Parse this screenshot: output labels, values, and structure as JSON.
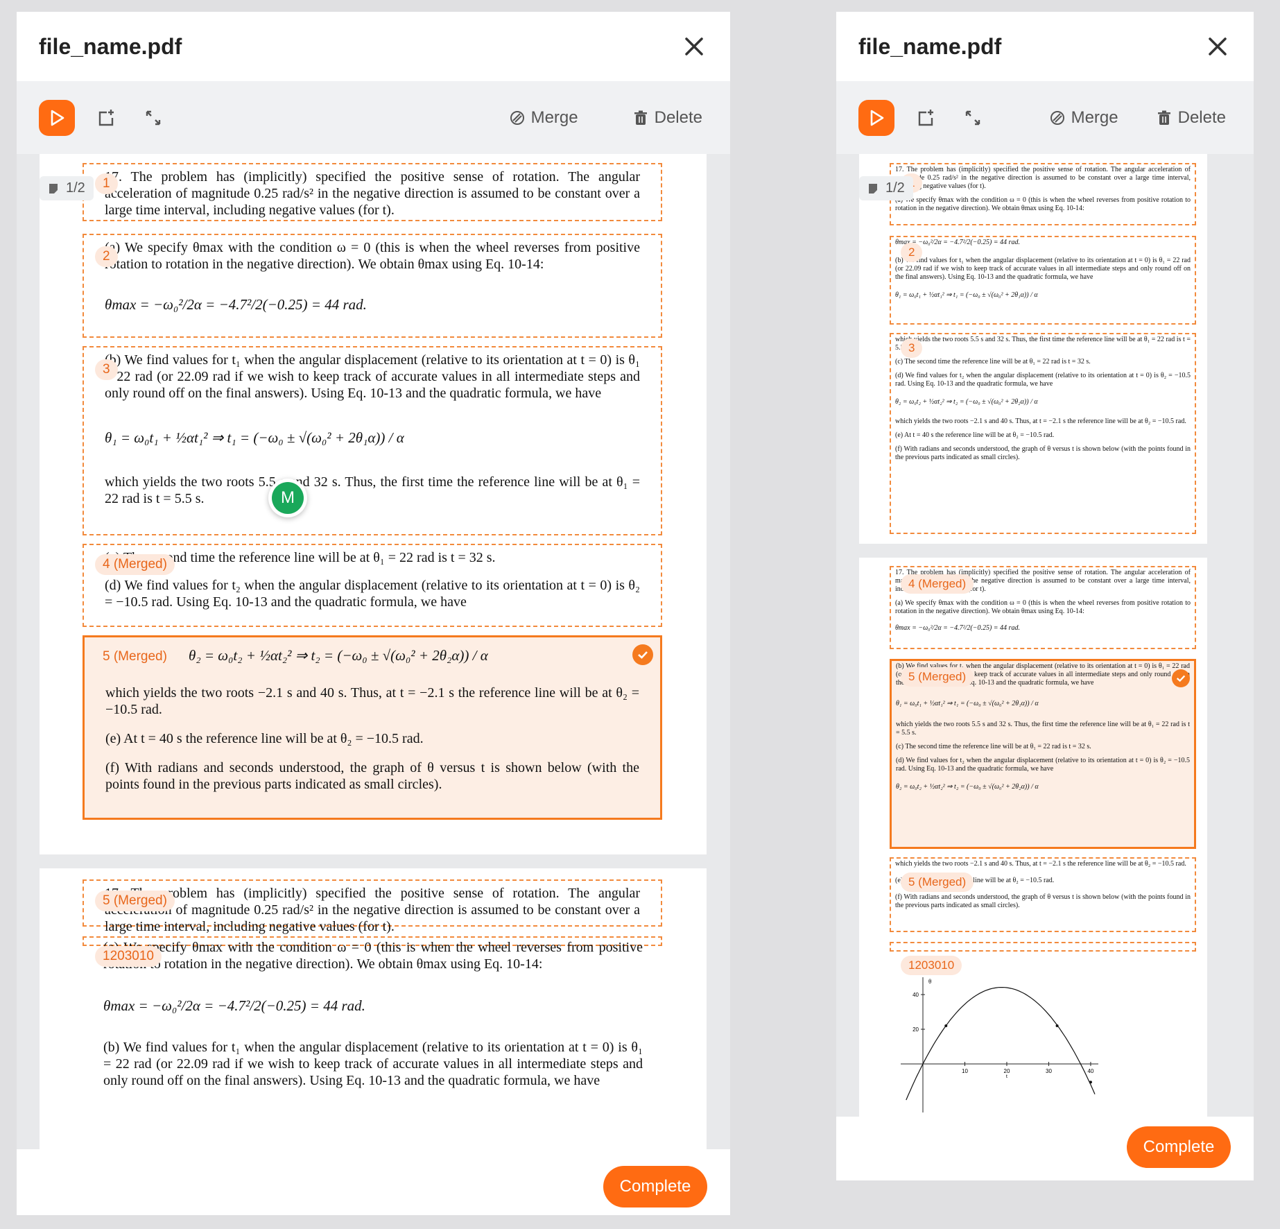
{
  "app": {
    "file_name": "file_name.pdf",
    "merge_label": "Merge",
    "delete_label": "Delete",
    "complete_label": "Complete",
    "page_indicator": "1/2",
    "avatar_initial": "M",
    "colors": {
      "accent": "#ff6b12",
      "selected_bg": "#fdeee4",
      "avatar": "#1aa85a"
    }
  },
  "left": {
    "tags": {
      "t1": "1",
      "t2": "2",
      "t3": "3",
      "t4": "4 (Merged)",
      "t5": "5 (Merged)",
      "t6": "5 (Merged)",
      "t7": "1203010"
    },
    "text": {
      "s1": "17. The problem has (implicitly) specified the positive sense of rotation. The angular acceleration of magnitude 0.25 rad/s² in the negative direction is assumed to be constant over a large time interval, including negative values (for t).",
      "s2": "(a) We specify θmax with the condition ω = 0 (this is when the wheel reverses from positive rotation to rotation in the negative direction). We obtain θmax using Eq. 10-14:",
      "s2eq": "θmax = −ω₀²/2α = −4.7²/2(−0.25) = 44 rad.",
      "s3": "(b) We find values for t₁ when the angular displacement (relative to its orientation at t = 0) is θ₁ = 22 rad (or 22.09 rad if we wish to keep track of accurate values in all intermediate steps and only round off on the final answers). Using Eq. 10-13 and the quadratic formula, we have",
      "s3eq": "θ₁ = ω₀t₁ + ½αt₁² ⇒ t₁ = (−ω₀ ± √(ω₀² + 2θ₁α)) / α",
      "s3b": "which yields the two roots 5.5 s and 32 s. Thus, the first time the reference line will be at θ₁ = 22 rad is t = 5.5 s.",
      "s4a": "(c) The second time the reference line will be at θ₁ = 22 rad is t = 32 s.",
      "s4b": "(d) We find values for t₂ when the angular displacement (relative to its orientation at t = 0) is θ₂ = −10.5 rad. Using Eq. 10-13 and the quadratic formula, we have",
      "s5eq": "θ₂ = ω₀t₂ + ½αt₂² ⇒ t₂ = (−ω₀ ± √(ω₀² + 2θ₂α)) / α",
      "s5a": "which yields the two roots −2.1 s and 40 s. Thus, at t = −2.1 s the reference line will be at θ₂ = −10.5 rad.",
      "s5b": "(e) At t = 40 s the reference line will be at θ₂ = −10.5 rad.",
      "s5c": "(f) With radians and seconds understood, the graph of θ versus t is shown below (with the points found in the previous parts indicated as small circles).",
      "p2a": "17. The problem has (implicitly) specified the positive sense of rotation. The angular acceleration of magnitude 0.25 rad/s² in the negative direction is assumed to be constant over a large time interval, including negative values (for t).",
      "p2b": "(a) We specify θmax with the condition ω = 0 (this is when the wheel reverses from positive rotation to rotation in the negative direction). We obtain θmax using Eq. 10-14:",
      "p2eq": "θmax = −ω₀²/2α = −4.7²/2(−0.25) = 44 rad.",
      "p2c": "(b) We find values for t₁ when the angular displacement (relative to its orientation at t = 0) is θ₁ = 22 rad (or 22.09 rad if we wish to keep track of accurate values in all intermediate steps and only round off on the final answers). Using Eq. 10-13 and the quadratic formula, we have"
    }
  },
  "right": {
    "tags": {
      "t1": "1",
      "t2": "2",
      "t3": "3",
      "t4": "4 (Merged)",
      "t5": "5 (Merged)",
      "t6": "5 (Merged)",
      "t7": "1203010"
    },
    "text": {
      "a1": "17. The problem has (implicitly) specified the positive sense of rotation. The angular acceleration of magnitude 0.25 rad/s² in the negative direction is assumed to be constant over a large time interval, including negative values (for t).",
      "a2": "(a) We specify θmax with the condition ω = 0 (this is when the wheel reverses from positive rotation to rotation in the negative direction). We obtain θmax using Eq. 10-14:",
      "a3eq": "θmax = −ω₀²/2α = −4.7²/2(−0.25) = 44 rad.",
      "a3": "(b) We find values for t₁ when the angular displacement (relative to its orientation at t = 0) is θ₁ = 22 rad (or 22.09 rad if we wish to keep track of accurate values in all intermediate steps and only round off on the final answers). Using Eq. 10-13 and the quadratic formula, we have",
      "a3eq2": "θ₁ = ω₀t₁ + ½αt₁² ⇒ t₁ = (−ω₀ ± √(ω₀² + 2θ₁α)) / α",
      "a4": "which yields the two roots 5.5 s and 32 s. Thus, the first time the reference line will be at θ₁ = 22 rad is t = 5.5 s.",
      "a5": "(c) The second time the reference line will be at θ₁ = 22 rad is t = 32 s.",
      "a6": "(d) We find values for t₂ when the angular displacement (relative to its orientation at t = 0) is θ₂ = −10.5 rad. Using Eq. 10-13 and the quadratic formula, we have",
      "a6eq": "θ₂ = ω₀t₂ + ½αt₂² ⇒ t₂ = (−ω₀ ± √(ω₀² + 2θ₂α)) / α",
      "a7": "which yields the two roots −2.1 s and 40 s. Thus, at t = −2.1 s the reference line will be at θ₂ = −10.5 rad.",
      "a8": "(e) At t = 40 s the reference line will be at θ₂ = −10.5 rad.",
      "a9": "(f) With radians and seconds understood, the graph of θ versus t is shown below (with the points found in the previous parts indicated as small circles)."
    }
  },
  "chart_data": {
    "type": "line",
    "xlabel": "t",
    "ylabel": "θ",
    "x_ticks": [
      "10",
      "20",
      "30",
      "40"
    ],
    "y_ticks": [
      "20",
      "40"
    ],
    "x": [
      -4,
      0,
      5.5,
      10,
      18.8,
      25,
      32,
      40,
      41
    ],
    "y": [
      -20,
      0,
      22,
      37,
      44,
      39,
      22,
      -10.5,
      -15
    ]
  }
}
